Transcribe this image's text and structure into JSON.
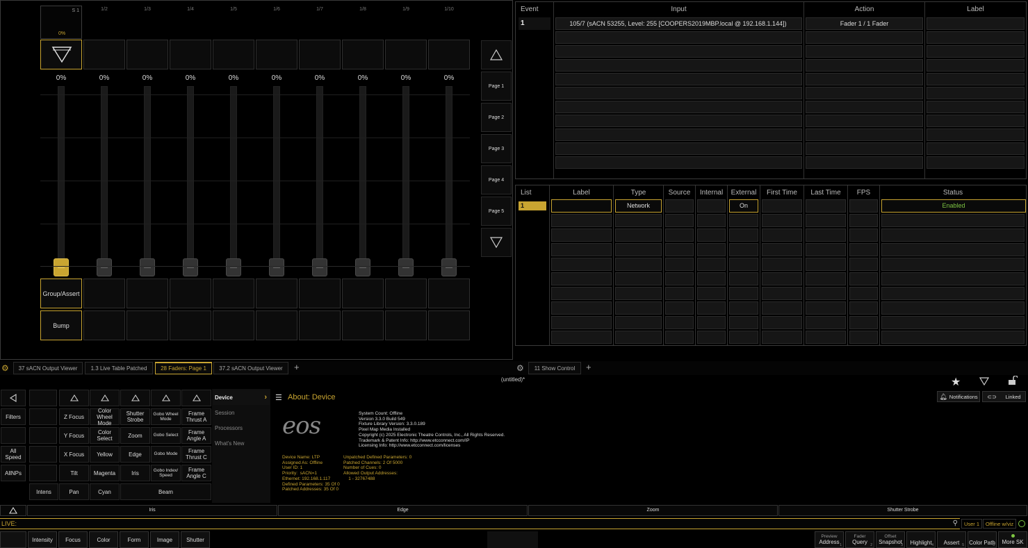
{
  "colors": {
    "accent": "#c9a531",
    "enabled": "#7ec542",
    "live": "#c9a531"
  },
  "faders": {
    "master_label": "S 1",
    "master_pct": "0%",
    "numbers": [
      "1/2",
      "1/3",
      "1/4",
      "1/5",
      "1/6",
      "1/7",
      "1/8",
      "1/9",
      "1/10"
    ],
    "levels": [
      "0%",
      "0%",
      "0%",
      "0%",
      "0%",
      "0%",
      "0%",
      "0%",
      "0%",
      "0%"
    ],
    "group_assert": "Group/Assert",
    "bump": "Bump",
    "pages": [
      "Page 1",
      "Page 2",
      "Page 3",
      "Page 4",
      "Page 5"
    ]
  },
  "show_control": {
    "top": {
      "headers": [
        "Event",
        "Input",
        "Action",
        "Label"
      ],
      "row": {
        "event": "1",
        "input": "105/7 (sACN  53255, Level: 255 [COOPERS2019MBP.local @ 192.168.1.144])",
        "action": "Fader  1 / 1 Fader",
        "label": ""
      }
    },
    "bottom": {
      "headers": [
        "List",
        "Label",
        "Type",
        "Source",
        "Internal",
        "External",
        "First Time",
        "Last Time",
        "FPS",
        "Status"
      ],
      "row": {
        "list": "1",
        "label": "",
        "type": "Network",
        "external": "On",
        "status": "Enabled"
      }
    }
  },
  "tabs_left": [
    "37 sACN Output Viewer",
    "1.3 Live Table Patched",
    "28 Faders: Page 1",
    "37.2 sACN Output Viewer"
  ],
  "tabs_right": [
    "11 Show Control"
  ],
  "title": "(untitled)*",
  "direct_selects": {
    "filters": "Filters",
    "all_speed": "All Speed",
    "allnps": "AllNPs",
    "rows": [
      [
        "Z Focus",
        "Color Wheel Mode",
        "Shutter Strobe",
        "Gobo Wheel Mode",
        "Frame Thrust A"
      ],
      [
        "Y Focus",
        "Color Select",
        "Zoom",
        "Gobo Select",
        "Frame Angle A"
      ],
      [
        "X Focus",
        "Yellow",
        "Edge",
        "Gobo Mode",
        "Frame Thrust C"
      ],
      [
        "Tilt",
        "Magenta",
        "Iris",
        "Gobo Index/ Speed",
        "Frame Angle C"
      ]
    ],
    "bottom": [
      "Intens",
      "Pan",
      "Cyan",
      "Beam"
    ]
  },
  "about": {
    "menu_title": "Device",
    "menu_items": [
      "Session",
      "Processors",
      "What's New"
    ],
    "title": "About: Device",
    "logo": "eos",
    "system": "System Count: Offline\nVersion 3.3.0 Build 549\nFixture Library Version: 3.3.0.189\nPixel Map Media Installed\nCopyright (c) 2025 Electronic Theatre Controls, Inc., All Rights Reserved.\nTrademark & Patent Info: http://www.etcconnect.com/IP\nLicensing Info: http://www.etcconnect.com/licenses",
    "device_left": "Device Name: LTP\nAssigned As: Offline\nUser ID: 1\nPriority:  sACN=1\nEthernet: 192.168.1.117\nDefined Parameters: 35 Of 0\nPatched Addresses: 35 Of 0",
    "device_right": "Unpatched Defined Parameters: 0\nPatched Channels: 2 Of 5000\nNumber of Cues: 0\nAllowed Output Addresses:\n    1 - 32767488",
    "notifications": "Notifications",
    "linked": "Linked"
  },
  "categories": [
    "Iris",
    "Edge",
    "Zoom",
    "Shutter Strobe"
  ],
  "command_line": {
    "prompt": "LIVE:",
    "user": "User 1",
    "status": "Offline w/viz"
  },
  "param_tabs": [
    "Intensity",
    "Focus",
    "Color",
    "Form",
    "Image",
    "Shutter"
  ],
  "softkeys": [
    {
      "sup": "Preview",
      "label": "Address",
      "n": "1"
    },
    {
      "sup": "Fader",
      "label": "Query",
      "n": "2"
    },
    {
      "sup": "Offset",
      "label": "Snapshot",
      "n": "3"
    },
    {
      "sup": "",
      "label": "Highlight",
      "n": "4"
    },
    {
      "sup": "",
      "label": "Assert",
      "n": "5"
    },
    {
      "sup": "",
      "label": "Color Path",
      "n": "6"
    },
    {
      "sup": "",
      "label": "More SK",
      "n": ""
    }
  ]
}
